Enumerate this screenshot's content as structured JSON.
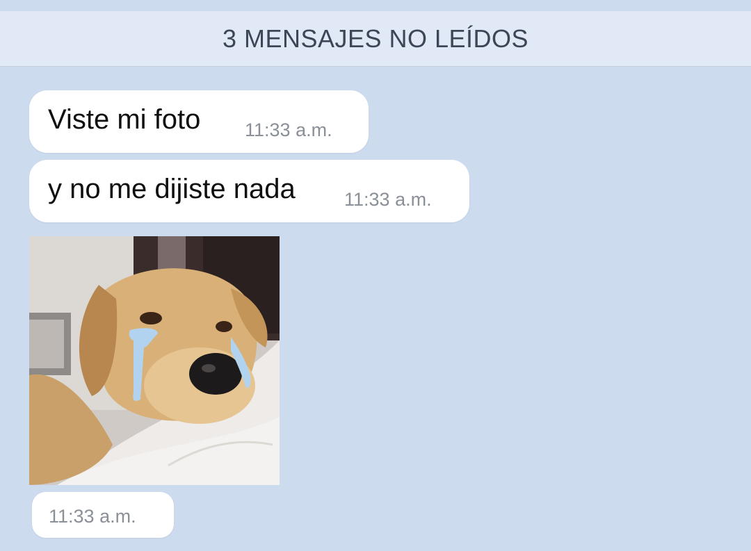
{
  "banner": {
    "unread_label": "3 MENSAJES NO LEÍDOS"
  },
  "messages": [
    {
      "text": "Viste mi foto",
      "time": "11:33 a.m."
    },
    {
      "text": "y no me dijiste nada",
      "time": "11:33 a.m."
    },
    {
      "type": "photo",
      "time": "11:33 a.m."
    }
  ],
  "colors": {
    "background": "#cddbef",
    "banner": "#e1e9f7",
    "bubble": "#ffffff",
    "time_text": "#8a8f98"
  }
}
